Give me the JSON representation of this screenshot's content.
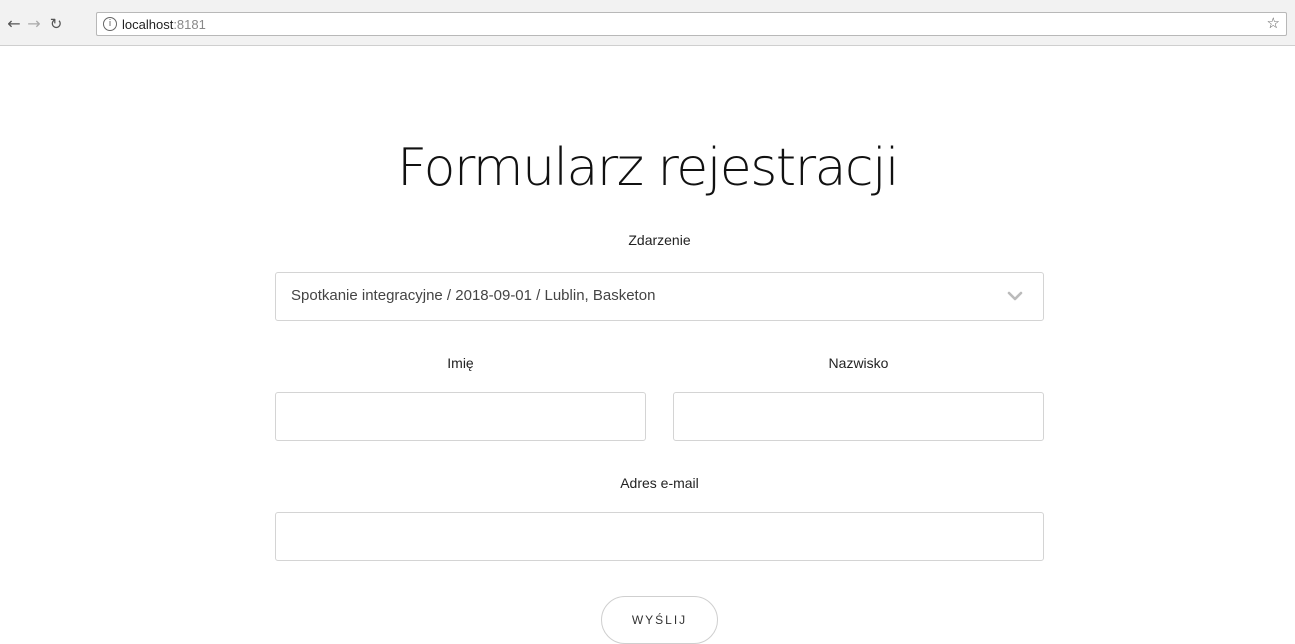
{
  "browser": {
    "back_icon": "arrow-left-icon",
    "forward_icon": "arrow-right-icon",
    "reload_icon": "reload-icon",
    "info_icon": "info-icon",
    "url_host": "localhost",
    "url_port": ":8181",
    "bookmark_icon": "star-icon"
  },
  "form": {
    "title": "Formularz rejestracji",
    "event_label": "Zdarzenie",
    "event_selected": "Spotkanie integracyjne / 2018-09-01 / Lublin, Basketon",
    "first_name_label": "Imię",
    "first_name_value": "",
    "last_name_label": "Nazwisko",
    "last_name_value": "",
    "email_label": "Adres e-mail",
    "email_value": "",
    "submit_label": "WYŚLIJ"
  }
}
